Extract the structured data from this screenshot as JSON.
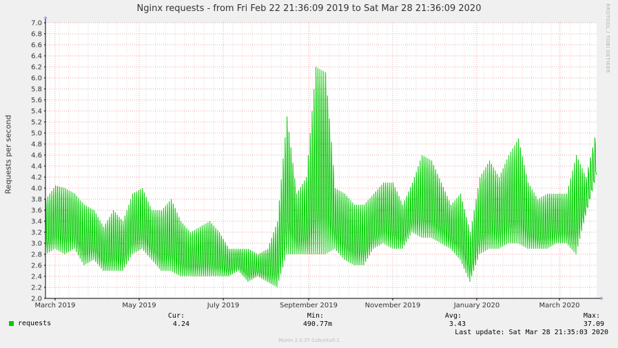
{
  "title": "Nginx requests - from Fri Feb 22 21:36:09 2019 to Sat Mar 28 21:36:09 2020",
  "watermark": "RRDTOOL / TOBI OETIKER",
  "footer": "Munin 2.0.37-1ubuntu0.1",
  "legend": {
    "series_name": "requests",
    "cur_label": "Cur:",
    "cur_value": "4.24",
    "min_label": "Min:",
    "min_value": "490.77m",
    "avg_label": "Avg:",
    "avg_value": "3.43",
    "max_label": "Max:",
    "max_value": "37.09",
    "last_update": "Last update: Sat Mar 28 21:35:03 2020"
  },
  "colors": {
    "series": "#00cc00",
    "plot_bg": "#ffffff",
    "grid_major": "#e8a0a0",
    "grid_minor": "#f3cccc",
    "axis": "#000000"
  },
  "chart_data": {
    "type": "line",
    "title": "Nginx requests - from Fri Feb 22 21:36:09 2019 to Sat Mar 28 21:36:09 2020",
    "xlabel": "",
    "ylabel": "Requests per second",
    "ylim": [
      2.0,
      7.0
    ],
    "yticks": [
      "2.0",
      "2.2",
      "2.4",
      "2.6",
      "2.8",
      "3.0",
      "3.2",
      "3.4",
      "3.6",
      "3.8",
      "4.0",
      "4.2",
      "4.4",
      "4.6",
      "4.8",
      "5.0",
      "5.2",
      "5.4",
      "5.6",
      "5.8",
      "6.0",
      "6.2",
      "6.4",
      "6.6",
      "6.8",
      "7.0"
    ],
    "xlim": [
      "2019-02-22",
      "2020-03-28"
    ],
    "xticks": [
      {
        "date": "2019-03-01",
        "label": "March 2019"
      },
      {
        "date": "2019-05-01",
        "label": "May 2019"
      },
      {
        "date": "2019-07-01",
        "label": "July 2019"
      },
      {
        "date": "2019-09-01",
        "label": "September 2019"
      },
      {
        "date": "2019-11-01",
        "label": "November 2019"
      },
      {
        "date": "2020-01-01",
        "label": "January 2020"
      },
      {
        "date": "2020-03-01",
        "label": "March 2020"
      }
    ],
    "grid": true,
    "series": [
      {
        "name": "requests",
        "x": [
          "2019-02-22",
          "2019-03-01",
          "2019-03-08",
          "2019-03-15",
          "2019-03-22",
          "2019-03-29",
          "2019-04-05",
          "2019-04-12",
          "2019-04-19",
          "2019-04-26",
          "2019-05-03",
          "2019-05-10",
          "2019-05-17",
          "2019-05-24",
          "2019-05-31",
          "2019-06-07",
          "2019-06-14",
          "2019-06-21",
          "2019-06-28",
          "2019-07-05",
          "2019-07-12",
          "2019-07-19",
          "2019-07-26",
          "2019-08-02",
          "2019-08-09",
          "2019-08-16",
          "2019-08-23",
          "2019-08-30",
          "2019-09-06",
          "2019-09-13",
          "2019-09-20",
          "2019-09-27",
          "2019-10-04",
          "2019-10-11",
          "2019-10-18",
          "2019-10-25",
          "2019-11-01",
          "2019-11-08",
          "2019-11-15",
          "2019-11-22",
          "2019-11-29",
          "2019-12-06",
          "2019-12-13",
          "2019-12-20",
          "2019-12-27",
          "2020-01-03",
          "2020-01-10",
          "2020-01-17",
          "2020-01-24",
          "2020-01-31",
          "2020-02-07",
          "2020-02-14",
          "2020-02-21",
          "2020-02-28",
          "2020-03-06",
          "2020-03-13",
          "2020-03-20",
          "2020-03-28"
        ],
        "high": [
          3.8,
          4.05,
          4.0,
          3.9,
          3.7,
          3.6,
          3.3,
          3.6,
          3.4,
          3.9,
          4.0,
          3.6,
          3.6,
          3.8,
          3.4,
          3.2,
          3.3,
          3.4,
          3.2,
          2.9,
          2.9,
          2.9,
          2.8,
          2.9,
          3.4,
          5.3,
          3.9,
          4.2,
          6.2,
          6.1,
          4.0,
          3.9,
          3.7,
          3.7,
          3.9,
          4.1,
          4.1,
          3.7,
          4.1,
          4.6,
          4.5,
          4.1,
          3.7,
          3.9,
          3.2,
          4.2,
          4.5,
          4.2,
          4.6,
          4.9,
          4.1,
          3.8,
          3.9,
          3.9,
          3.9,
          4.6,
          4.2,
          5.1
        ],
        "low": [
          2.8,
          2.9,
          2.8,
          2.9,
          2.6,
          2.7,
          2.5,
          2.5,
          2.5,
          2.8,
          2.9,
          2.7,
          2.5,
          2.5,
          2.4,
          2.4,
          2.4,
          2.4,
          2.4,
          2.4,
          2.5,
          2.3,
          2.4,
          2.3,
          2.2,
          2.8,
          2.8,
          2.8,
          2.8,
          2.8,
          2.9,
          2.7,
          2.6,
          2.6,
          2.9,
          3.0,
          2.9,
          2.9,
          3.2,
          3.1,
          3.1,
          3.0,
          2.9,
          2.7,
          2.3,
          2.8,
          2.9,
          2.9,
          3.0,
          3.0,
          2.9,
          2.9,
          2.9,
          3.0,
          3.0,
          2.8,
          3.5,
          4.24
        ]
      }
    ]
  }
}
